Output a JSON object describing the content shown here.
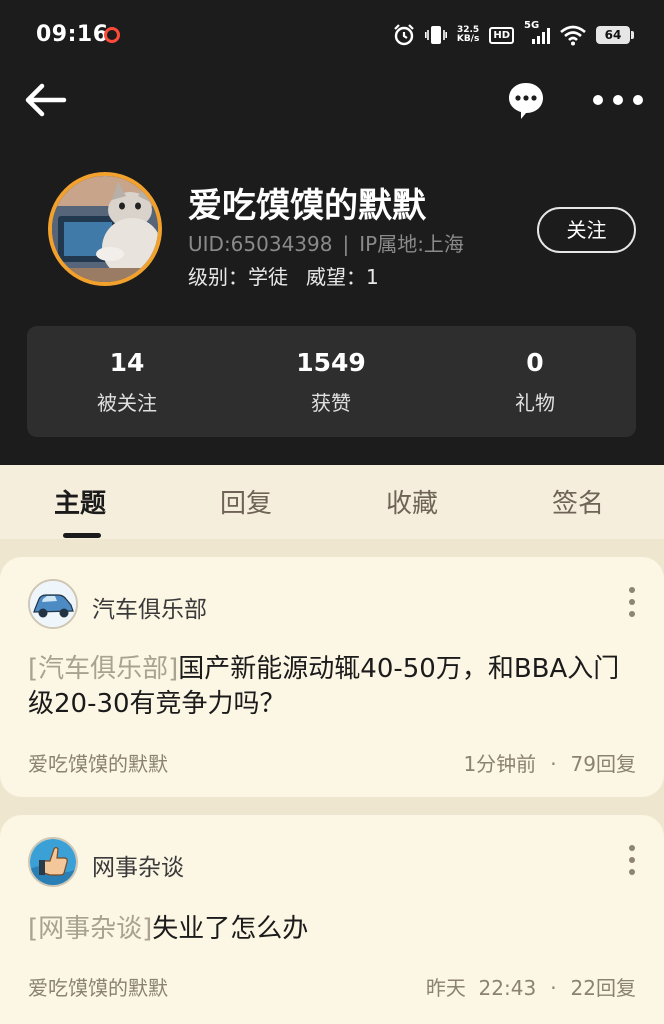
{
  "status_bar": {
    "time": "09:16",
    "net_speed_value": "32.5",
    "net_speed_unit": "KB/s",
    "hd": "HD",
    "network": "5G",
    "battery": "64",
    "icons": [
      "alarm-icon",
      "vibrate-icon",
      "signal-icon",
      "wifi-icon",
      "battery-icon"
    ]
  },
  "profile": {
    "username": "爱吃馍馍的默默",
    "uid": "UID:65034398",
    "separator": "|",
    "ip_location": "IP属地:上海",
    "level_label": "级别：学徒",
    "prestige_label": "威望：1",
    "follow_label": "关注"
  },
  "stats": [
    {
      "value": "14",
      "label": "被关注"
    },
    {
      "value": "1549",
      "label": "获赞"
    },
    {
      "value": "0",
      "label": "礼物"
    }
  ],
  "tabs": [
    {
      "label": "主题",
      "active": true
    },
    {
      "label": "回复",
      "active": false
    },
    {
      "label": "收藏",
      "active": false
    },
    {
      "label": "签名",
      "active": false
    }
  ],
  "posts": [
    {
      "forum": "汽车俱乐部",
      "tag": "[汽车俱乐部]",
      "title": "国产新能源动辄40-50万，和BBA入门级20-30有竞争力吗？",
      "author": "爱吃馍馍的默默",
      "time": "1分钟前",
      "dot": "·",
      "replies": "79回复"
    },
    {
      "forum": "网事杂谈",
      "tag": "[网事杂谈]",
      "title": "失业了怎么办",
      "author": "爱吃馍馍的默默",
      "time": "昨天  22:43",
      "dot": "·",
      "replies": "22回复"
    }
  ],
  "colors": {
    "header_bg": "#1c1c1c",
    "page_bg": "#f6eedd",
    "avatar_ring": "#f2a12c",
    "card_bg": "#fcf6e4",
    "recording_dot": "#ff4a3a"
  }
}
